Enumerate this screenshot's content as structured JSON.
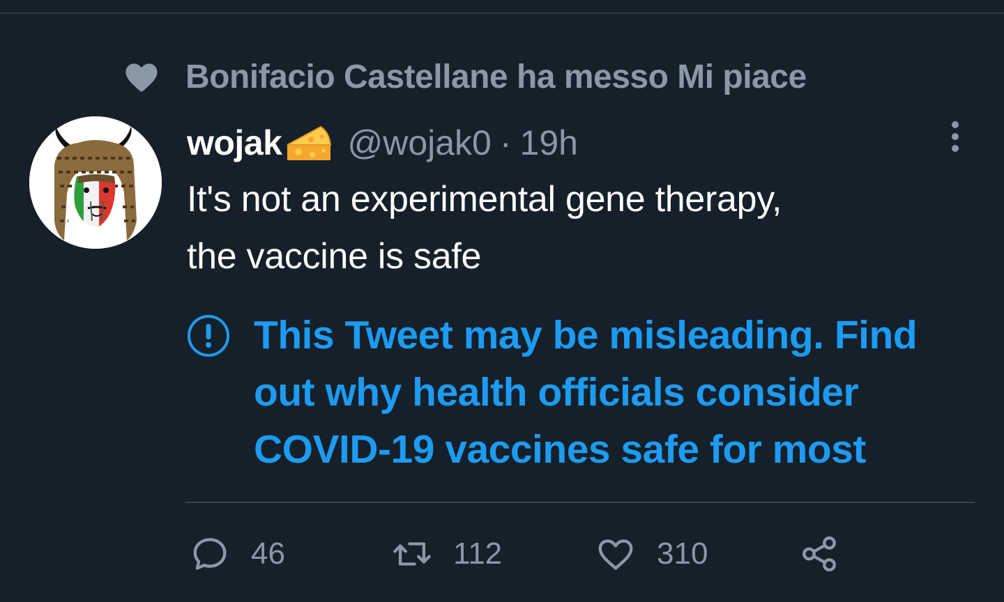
{
  "social_context": {
    "text": "Bonifacio Castellane ha messo Mi piace",
    "icon": "heart-filled-icon"
  },
  "tweet": {
    "author": {
      "display_name": "wojak",
      "emoji": "cheese-emoji",
      "handle": "@wojak0",
      "separator": "·",
      "time": "19h"
    },
    "text_line1": "It's not an experimental gene therapy,",
    "text_line2": "the vaccine is safe",
    "notice": {
      "icon": "exclamation-circle-icon",
      "text": "This Tweet may be misleading. Find out why health officials consider COVID-19 vaccines safe for most"
    },
    "actions": {
      "reply_count": "46",
      "retweet_count": "112",
      "like_count": "310"
    }
  },
  "colors": {
    "background": "#15202b",
    "primary_text": "#ffffff",
    "secondary_text": "#8b98a5",
    "accent": "#1d9bf0",
    "divider": "#38444d"
  }
}
